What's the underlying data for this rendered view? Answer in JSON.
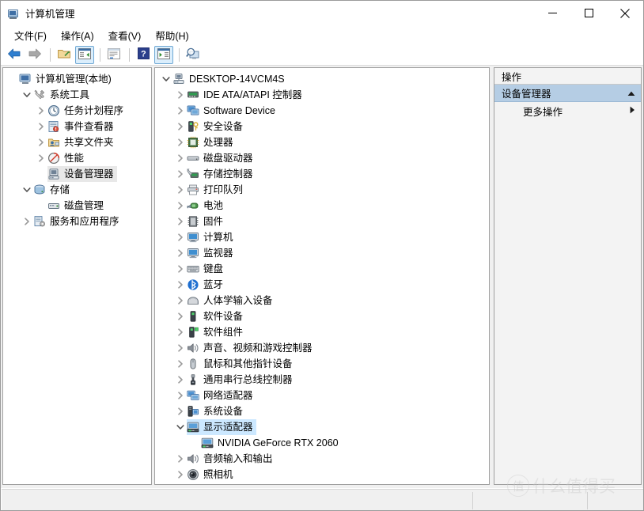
{
  "window": {
    "title": "计算机管理",
    "icon": "computer-management-icon",
    "buttons": [
      {
        "name": "minimize-button",
        "glyph": "minimize-icon"
      },
      {
        "name": "maximize-button",
        "glyph": "maximize-icon"
      },
      {
        "name": "close-button",
        "glyph": "close-icon"
      }
    ]
  },
  "menubar": {
    "items": [
      {
        "label": "文件(F)",
        "name": "menu-file"
      },
      {
        "label": "操作(A)",
        "name": "menu-action"
      },
      {
        "label": "查看(V)",
        "name": "menu-view"
      },
      {
        "label": "帮助(H)",
        "name": "menu-help"
      }
    ]
  },
  "toolbar": {
    "buttons": [
      {
        "name": "back-button",
        "icon": "back-arrow-icon",
        "checked": false
      },
      {
        "name": "forward-button",
        "icon": "forward-arrow-icon",
        "checked": false
      },
      {
        "name": "up-one-level-button",
        "icon": "folder-up-icon",
        "checked": false
      },
      {
        "name": "show-hide-console-tree-button",
        "icon": "console-tree-icon",
        "checked": true
      },
      {
        "name": "properties-button",
        "icon": "properties-icon",
        "checked": false
      },
      {
        "name": "help-button",
        "icon": "help-question-icon",
        "checked": false
      },
      {
        "name": "show-hide-action-pane-button",
        "icon": "action-pane-icon",
        "checked": true
      },
      {
        "name": "scan-hardware-changes-button",
        "icon": "magnifier-monitor-icon",
        "checked": false
      }
    ]
  },
  "sidebar": {
    "items": [
      {
        "label": "计算机管理(本地)",
        "icon": "computer-management-icon",
        "indent": 0,
        "twisty": "none",
        "selected": "none"
      },
      {
        "label": "系统工具",
        "icon": "system-tools-icon",
        "indent": 1,
        "twisty": "expanded",
        "selected": "none"
      },
      {
        "label": "任务计划程序",
        "icon": "task-scheduler-clock-icon",
        "indent": 2,
        "twisty": "collapsed",
        "selected": "none"
      },
      {
        "label": "事件查看器",
        "icon": "event-viewer-icon",
        "indent": 2,
        "twisty": "collapsed",
        "selected": "none"
      },
      {
        "label": "共享文件夹",
        "icon": "shared-folders-icon",
        "indent": 2,
        "twisty": "collapsed",
        "selected": "none"
      },
      {
        "label": "性能",
        "icon": "performance-icon",
        "indent": 2,
        "twisty": "collapsed",
        "selected": "none"
      },
      {
        "label": "设备管理器",
        "icon": "device-manager-icon",
        "indent": 2,
        "twisty": "none",
        "selected": "gray"
      },
      {
        "label": "存储",
        "icon": "storage-icon",
        "indent": 1,
        "twisty": "expanded",
        "selected": "none"
      },
      {
        "label": "磁盘管理",
        "icon": "disk-management-icon",
        "indent": 2,
        "twisty": "none",
        "selected": "none"
      },
      {
        "label": "服务和应用程序",
        "icon": "services-and-applications-icon",
        "indent": 1,
        "twisty": "collapsed",
        "selected": "none"
      }
    ]
  },
  "device_tree": {
    "items": [
      {
        "label": "DESKTOP-14VCM4S",
        "icon": "computer-root-icon",
        "indent": 0,
        "twisty": "expanded",
        "selected": "none"
      },
      {
        "label": "IDE ATA/ATAPI 控制器",
        "icon": "ide-controller-icon",
        "indent": 1,
        "twisty": "collapsed",
        "selected": "none"
      },
      {
        "label": "Software Device",
        "icon": "software-device-icon",
        "indent": 1,
        "twisty": "collapsed",
        "selected": "none"
      },
      {
        "label": "安全设备",
        "icon": "security-device-icon",
        "indent": 1,
        "twisty": "collapsed",
        "selected": "none"
      },
      {
        "label": "处理器",
        "icon": "processor-icon",
        "indent": 1,
        "twisty": "collapsed",
        "selected": "none"
      },
      {
        "label": "磁盘驱动器",
        "icon": "disk-drive-icon",
        "indent": 1,
        "twisty": "collapsed",
        "selected": "none"
      },
      {
        "label": "存储控制器",
        "icon": "storage-controller-icon",
        "indent": 1,
        "twisty": "collapsed",
        "selected": "none"
      },
      {
        "label": "打印队列",
        "icon": "print-queue-icon",
        "indent": 1,
        "twisty": "collapsed",
        "selected": "none"
      },
      {
        "label": "电池",
        "icon": "battery-icon",
        "indent": 1,
        "twisty": "collapsed",
        "selected": "none"
      },
      {
        "label": "固件",
        "icon": "firmware-icon",
        "indent": 1,
        "twisty": "collapsed",
        "selected": "none"
      },
      {
        "label": "计算机",
        "icon": "computer-icon",
        "indent": 1,
        "twisty": "collapsed",
        "selected": "none"
      },
      {
        "label": "监视器",
        "icon": "monitor-icon",
        "indent": 1,
        "twisty": "collapsed",
        "selected": "none"
      },
      {
        "label": "键盘",
        "icon": "keyboard-icon",
        "indent": 1,
        "twisty": "collapsed",
        "selected": "none"
      },
      {
        "label": "蓝牙",
        "icon": "bluetooth-icon",
        "indent": 1,
        "twisty": "collapsed",
        "selected": "none"
      },
      {
        "label": "人体学输入设备",
        "icon": "hid-icon",
        "indent": 1,
        "twisty": "collapsed",
        "selected": "none"
      },
      {
        "label": "软件设备",
        "icon": "software-devices-icon",
        "indent": 1,
        "twisty": "collapsed",
        "selected": "none"
      },
      {
        "label": "软件组件",
        "icon": "software-component-icon",
        "indent": 1,
        "twisty": "collapsed",
        "selected": "none"
      },
      {
        "label": "声音、视频和游戏控制器",
        "icon": "sound-video-game-icon",
        "indent": 1,
        "twisty": "collapsed",
        "selected": "none"
      },
      {
        "label": "鼠标和其他指针设备",
        "icon": "mouse-icon",
        "indent": 1,
        "twisty": "collapsed",
        "selected": "none"
      },
      {
        "label": "通用串行总线控制器",
        "icon": "usb-controller-icon",
        "indent": 1,
        "twisty": "collapsed",
        "selected": "none"
      },
      {
        "label": "网络适配器",
        "icon": "network-adapter-icon",
        "indent": 1,
        "twisty": "collapsed",
        "selected": "none"
      },
      {
        "label": "系统设备",
        "icon": "system-device-icon",
        "indent": 1,
        "twisty": "collapsed",
        "selected": "none"
      },
      {
        "label": "显示适配器",
        "icon": "display-adapter-icon",
        "indent": 1,
        "twisty": "expanded",
        "selected": "blue"
      },
      {
        "label": "NVIDIA GeForce RTX 2060",
        "icon": "display-adapter-icon",
        "indent": 2,
        "twisty": "none",
        "selected": "none"
      },
      {
        "label": "音频输入和输出",
        "icon": "audio-io-icon",
        "indent": 1,
        "twisty": "collapsed",
        "selected": "none"
      },
      {
        "label": "照相机",
        "icon": "camera-icon",
        "indent": 1,
        "twisty": "collapsed",
        "selected": "none"
      }
    ]
  },
  "actions_pane": {
    "header": "操作",
    "group_label": "设备管理器",
    "group_chevron": "chevron-up-icon",
    "items": [
      {
        "label": "更多操作",
        "chevron": "chevron-right-icon",
        "name": "more-actions-item"
      }
    ]
  },
  "watermark": {
    "badge": "值",
    "text": "什么值得买"
  },
  "colors": {
    "selection_blue": "#cce8ff",
    "selection_gray": "#e8e8e8",
    "actions_group_blue": "#b5cde4",
    "toolbar_checked": "#dbeefc"
  }
}
